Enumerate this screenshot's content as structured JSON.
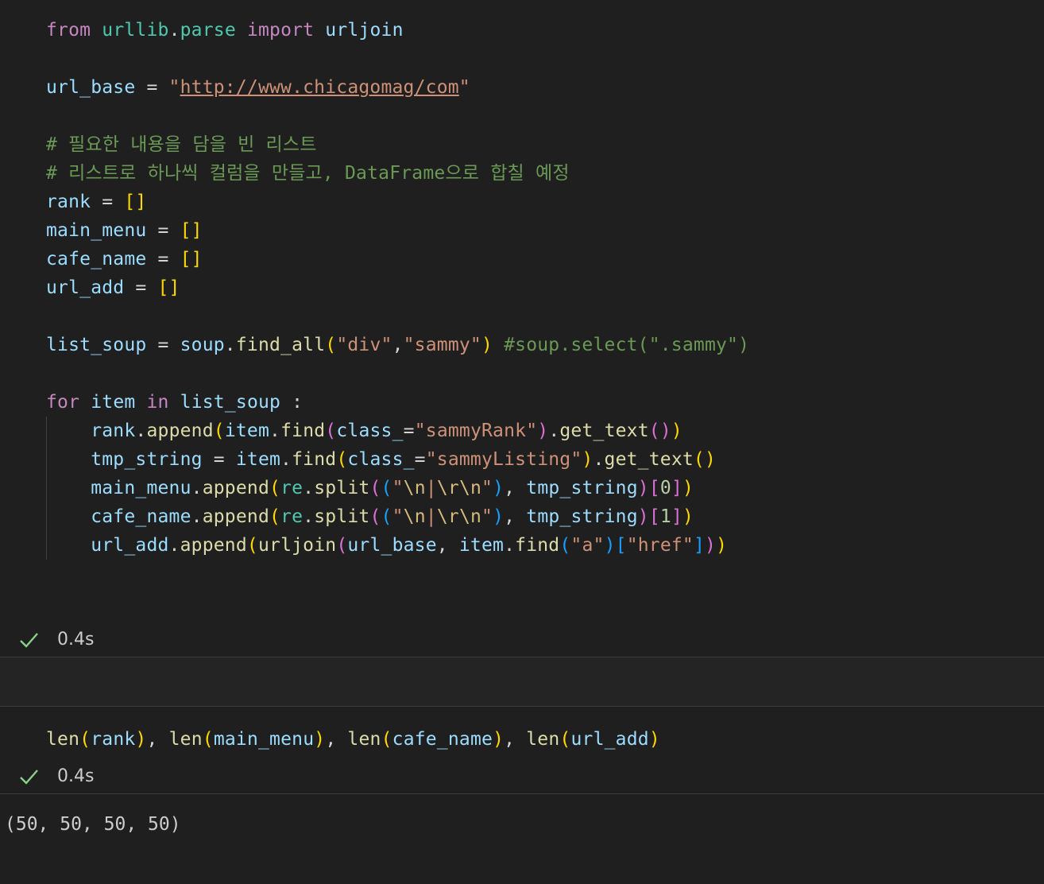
{
  "cell1": {
    "lines": [
      [
        [
          "kw",
          "from"
        ],
        [
          "op",
          " "
        ],
        [
          "mod",
          "urllib"
        ],
        [
          "op",
          "."
        ],
        [
          "mod",
          "parse"
        ],
        [
          "op",
          " "
        ],
        [
          "kw",
          "import"
        ],
        [
          "op",
          " "
        ],
        [
          "var",
          "urljoin"
        ]
      ],
      [],
      [
        [
          "var",
          "url_base"
        ],
        [
          "op",
          " = "
        ],
        [
          "str",
          "\""
        ],
        [
          "url",
          "http://www.chicagomag/com"
        ],
        [
          "str",
          "\""
        ]
      ],
      [],
      [
        [
          "cm",
          "# 필요한 내용을 담을 빈 리스트"
        ]
      ],
      [
        [
          "cm",
          "# 리스트로 하나씩 컬럼을 만들고, DataFrame으로 합칠 예정"
        ]
      ],
      [
        [
          "var",
          "rank"
        ],
        [
          "op",
          " = "
        ],
        [
          "b1",
          "[]"
        ]
      ],
      [
        [
          "var",
          "main_menu"
        ],
        [
          "op",
          " = "
        ],
        [
          "b1",
          "[]"
        ]
      ],
      [
        [
          "var",
          "cafe_name"
        ],
        [
          "op",
          " = "
        ],
        [
          "b1",
          "[]"
        ]
      ],
      [
        [
          "var",
          "url_add"
        ],
        [
          "op",
          " = "
        ],
        [
          "b1",
          "[]"
        ]
      ],
      [],
      [
        [
          "var",
          "list_soup"
        ],
        [
          "op",
          " = "
        ],
        [
          "var",
          "soup"
        ],
        [
          "op",
          "."
        ],
        [
          "fn",
          "find_all"
        ],
        [
          "b1",
          "("
        ],
        [
          "str",
          "\"div\""
        ],
        [
          "op",
          ","
        ],
        [
          "str",
          "\"sammy\""
        ],
        [
          "b1",
          ")"
        ],
        [
          "op",
          " "
        ],
        [
          "cm",
          "#soup.select(\".sammy\")"
        ]
      ],
      [],
      [
        [
          "kw",
          "for"
        ],
        [
          "op",
          " "
        ],
        [
          "var",
          "item"
        ],
        [
          "op",
          " "
        ],
        [
          "kw",
          "in"
        ],
        [
          "op",
          " "
        ],
        [
          "var",
          "list_soup"
        ],
        [
          "op",
          " :"
        ]
      ],
      [
        [
          "op",
          "    "
        ],
        [
          "var",
          "rank"
        ],
        [
          "op",
          "."
        ],
        [
          "fn",
          "append"
        ],
        [
          "b1",
          "("
        ],
        [
          "var",
          "item"
        ],
        [
          "op",
          "."
        ],
        [
          "fn",
          "find"
        ],
        [
          "b2",
          "("
        ],
        [
          "var",
          "class_"
        ],
        [
          "op",
          "="
        ],
        [
          "str",
          "\"sammyRank\""
        ],
        [
          "b2",
          ")"
        ],
        [
          "op",
          "."
        ],
        [
          "fn",
          "get_text"
        ],
        [
          "b2",
          "()"
        ],
        [
          "b1",
          ")"
        ]
      ],
      [
        [
          "op",
          "    "
        ],
        [
          "var",
          "tmp_string"
        ],
        [
          "op",
          " = "
        ],
        [
          "var",
          "item"
        ],
        [
          "op",
          "."
        ],
        [
          "fn",
          "find"
        ],
        [
          "b1",
          "("
        ],
        [
          "var",
          "class_"
        ],
        [
          "op",
          "="
        ],
        [
          "str",
          "\"sammyListing\""
        ],
        [
          "b1",
          ")"
        ],
        [
          "op",
          "."
        ],
        [
          "fn",
          "get_text"
        ],
        [
          "b1",
          "()"
        ]
      ],
      [
        [
          "op",
          "    "
        ],
        [
          "var",
          "main_menu"
        ],
        [
          "op",
          "."
        ],
        [
          "fn",
          "append"
        ],
        [
          "b1",
          "("
        ],
        [
          "mod",
          "re"
        ],
        [
          "op",
          "."
        ],
        [
          "fn",
          "split"
        ],
        [
          "b2",
          "("
        ],
        [
          "b3",
          "("
        ],
        [
          "str",
          "\""
        ],
        [
          "esc",
          "\\n"
        ],
        [
          "str",
          "|"
        ],
        [
          "esc",
          "\\r\\n"
        ],
        [
          "str",
          "\""
        ],
        [
          "b3",
          ")"
        ],
        [
          "op",
          ", "
        ],
        [
          "var",
          "tmp_string"
        ],
        [
          "b2",
          ")"
        ],
        [
          "b2",
          "["
        ],
        [
          "num",
          "0"
        ],
        [
          "b2",
          "]"
        ],
        [
          "b1",
          ")"
        ]
      ],
      [
        [
          "op",
          "    "
        ],
        [
          "var",
          "cafe_name"
        ],
        [
          "op",
          "."
        ],
        [
          "fn",
          "append"
        ],
        [
          "b1",
          "("
        ],
        [
          "mod",
          "re"
        ],
        [
          "op",
          "."
        ],
        [
          "fn",
          "split"
        ],
        [
          "b2",
          "("
        ],
        [
          "b3",
          "("
        ],
        [
          "str",
          "\""
        ],
        [
          "esc",
          "\\n"
        ],
        [
          "str",
          "|"
        ],
        [
          "esc",
          "\\r\\n"
        ],
        [
          "str",
          "\""
        ],
        [
          "b3",
          ")"
        ],
        [
          "op",
          ", "
        ],
        [
          "var",
          "tmp_string"
        ],
        [
          "b2",
          ")"
        ],
        [
          "b2",
          "["
        ],
        [
          "num",
          "1"
        ],
        [
          "b2",
          "]"
        ],
        [
          "b1",
          ")"
        ]
      ],
      [
        [
          "op",
          "    "
        ],
        [
          "var",
          "url_add"
        ],
        [
          "op",
          "."
        ],
        [
          "fn",
          "append"
        ],
        [
          "b1",
          "("
        ],
        [
          "fn",
          "urljoin"
        ],
        [
          "b2",
          "("
        ],
        [
          "var",
          "url_base"
        ],
        [
          "op",
          ", "
        ],
        [
          "var",
          "item"
        ],
        [
          "op",
          "."
        ],
        [
          "fn",
          "find"
        ],
        [
          "b3",
          "("
        ],
        [
          "str",
          "\"a\""
        ],
        [
          "b3",
          ")"
        ],
        [
          "b3",
          "["
        ],
        [
          "str",
          "\"href\""
        ],
        [
          "b3",
          "]"
        ],
        [
          "b2",
          ")"
        ],
        [
          "b1",
          ")"
        ]
      ]
    ],
    "status": {
      "check_icon": "checkmark-icon",
      "time": "0.4s"
    }
  },
  "cell2": {
    "lines": [
      [
        [
          "fn",
          "len"
        ],
        [
          "b1",
          "("
        ],
        [
          "var",
          "rank"
        ],
        [
          "b1",
          ")"
        ],
        [
          "op",
          ", "
        ],
        [
          "fn",
          "len"
        ],
        [
          "b1",
          "("
        ],
        [
          "var",
          "main_menu"
        ],
        [
          "b1",
          ")"
        ],
        [
          "op",
          ", "
        ],
        [
          "fn",
          "len"
        ],
        [
          "b1",
          "("
        ],
        [
          "var",
          "cafe_name"
        ],
        [
          "b1",
          ")"
        ],
        [
          "op",
          ", "
        ],
        [
          "fn",
          "len"
        ],
        [
          "b1",
          "("
        ],
        [
          "var",
          "url_add"
        ],
        [
          "b1",
          ")"
        ]
      ]
    ],
    "status": {
      "check_icon": "checkmark-icon",
      "time": "0.4s"
    },
    "output": "(50, 50, 50, 50)"
  },
  "colors": {
    "background": "#1f1f1f",
    "keyword": "#c586c0",
    "module": "#4ec9b0",
    "variable": "#9cdcfe",
    "function": "#dcdcaa",
    "string": "#ce9178",
    "comment": "#6a9955",
    "number": "#b5cea8",
    "check": "#89d185"
  }
}
